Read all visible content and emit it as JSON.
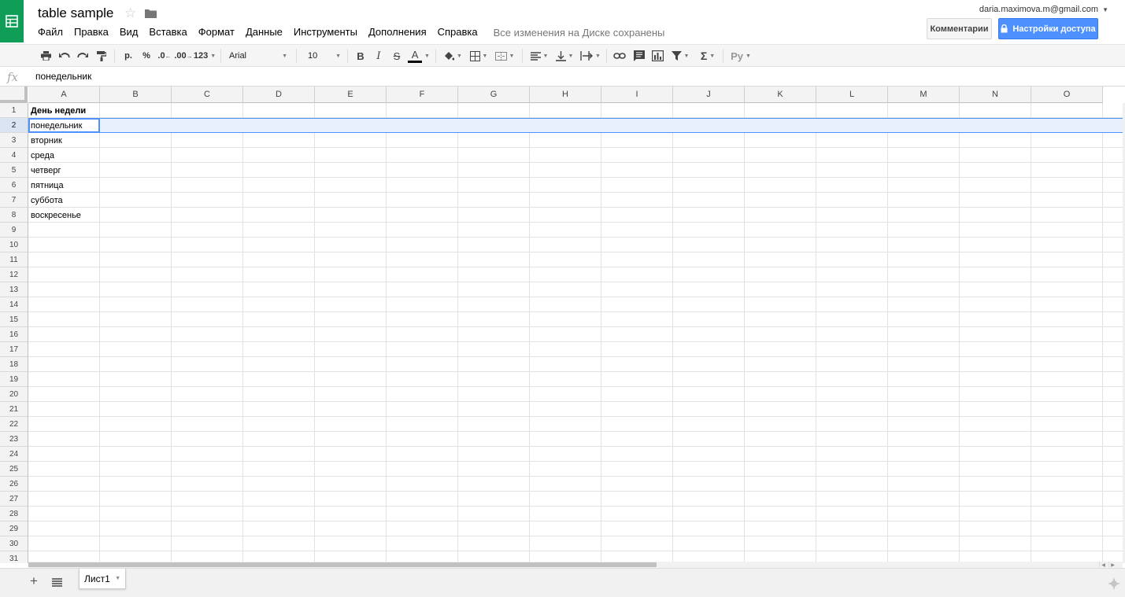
{
  "header": {
    "title": "table sample",
    "menu": [
      "Файл",
      "Правка",
      "Вид",
      "Вставка",
      "Формат",
      "Данные",
      "Инструменты",
      "Дополнения",
      "Справка"
    ],
    "save_status": "Все изменения на Диске сохранены",
    "account_email": "daria.maximova.m@gmail.com",
    "comments_label": "Комментарии",
    "share_label": "Настройки доступа"
  },
  "toolbar": {
    "currency_label": "р.",
    "percent_label": "%",
    "decrease_decimals_label": ".0",
    "increase_decimals_label": ".00",
    "more_formats_label": "123",
    "font_family": "Arial",
    "font_size": "10",
    "bold_label": "B",
    "italic_label": "I",
    "strike_label": "S",
    "text_color_label": "A",
    "sum_label": "Σ",
    "input_tools_label": "Ру",
    "colors": {
      "text_color_underline": "#000000",
      "share_blue": "#4d90fe",
      "brand_green": "#0f9d58"
    }
  },
  "formula_bar": {
    "fx_label": "fx",
    "value": "понедельник"
  },
  "grid": {
    "columns": [
      "A",
      "B",
      "C",
      "D",
      "E",
      "F",
      "G",
      "H",
      "I",
      "J",
      "K",
      "L",
      "M",
      "N",
      "O"
    ],
    "rows": [
      "1",
      "2",
      "3",
      "4",
      "5",
      "6",
      "7",
      "8",
      "9",
      "10",
      "11",
      "12",
      "13",
      "14",
      "15",
      "16",
      "17",
      "18",
      "19",
      "20",
      "21",
      "22",
      "23",
      "24",
      "25",
      "26",
      "27",
      "28",
      "29",
      "30",
      "31"
    ],
    "selected_row": "2",
    "active_cell": "A2",
    "cells": {
      "A1": "День недели",
      "A2": "понедельник",
      "A3": "вторник",
      "A4": "среда",
      "A5": "четверг",
      "A6": "пятница",
      "A7": "суббота",
      "A8": "воскресенье"
    }
  },
  "sheets": {
    "active_tab": "Лист1"
  }
}
